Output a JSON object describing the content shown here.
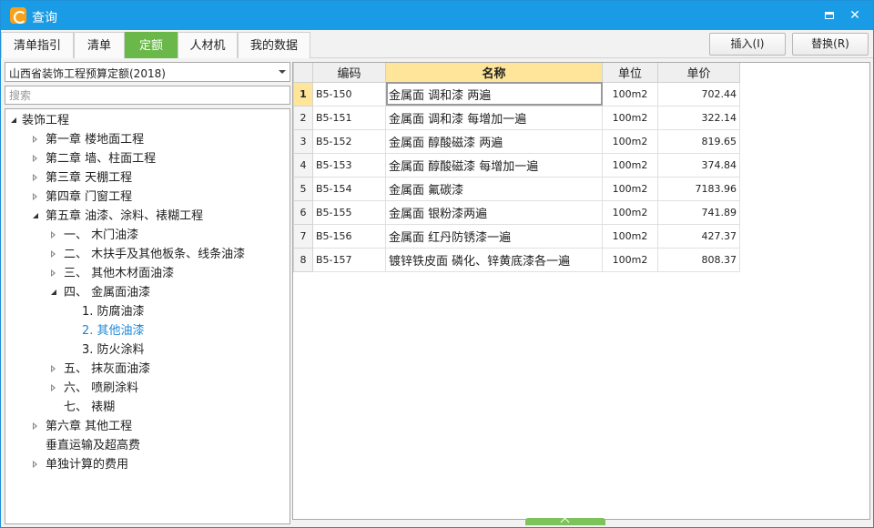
{
  "window": {
    "title": "查询"
  },
  "tabs": [
    {
      "label": "清单指引"
    },
    {
      "label": "清单"
    },
    {
      "label": "定额",
      "active": true
    },
    {
      "label": "人材机"
    },
    {
      "label": "我的数据"
    }
  ],
  "toolbar": {
    "insert_label": "插入(I)",
    "replace_label": "替换(R)"
  },
  "quota_library": {
    "selected": "山西省装饰工程预算定额(2018)"
  },
  "search": {
    "placeholder": "搜索"
  },
  "tree": [
    {
      "label": "装饰工程",
      "level": 0,
      "state": "open"
    },
    {
      "label": "第一章 楼地面工程",
      "level": 1,
      "state": "closed"
    },
    {
      "label": "第二章 墙、柱面工程",
      "level": 1,
      "state": "closed"
    },
    {
      "label": "第三章 天棚工程",
      "level": 1,
      "state": "closed"
    },
    {
      "label": "第四章 门窗工程",
      "level": 1,
      "state": "closed"
    },
    {
      "label": "第五章 油漆、涂料、裱糊工程",
      "level": 1,
      "state": "open"
    },
    {
      "label": "一、 木门油漆",
      "level": 2,
      "state": "closed"
    },
    {
      "label": "二、 木扶手及其他板条、线条油漆",
      "level": 2,
      "state": "closed"
    },
    {
      "label": "三、 其他木材面油漆",
      "level": 2,
      "state": "closed"
    },
    {
      "label": "四、 金属面油漆",
      "level": 2,
      "state": "open"
    },
    {
      "label": "1. 防腐油漆",
      "level": 3,
      "state": "leaf"
    },
    {
      "label": "2. 其他油漆",
      "level": 3,
      "state": "leaf",
      "selected": true
    },
    {
      "label": "3. 防火涂料",
      "level": 3,
      "state": "leaf"
    },
    {
      "label": "五、 抹灰面油漆",
      "level": 2,
      "state": "closed"
    },
    {
      "label": "六、 喷刷涂料",
      "level": 2,
      "state": "closed"
    },
    {
      "label": "七、 裱糊",
      "level": 2,
      "state": "leaf"
    },
    {
      "label": "第六章 其他工程",
      "level": 1,
      "state": "closed"
    },
    {
      "label": "垂直运输及超高费",
      "level": 1,
      "state": "leaf"
    },
    {
      "label": "单独计算的费用",
      "level": 1,
      "state": "closed"
    }
  ],
  "grid": {
    "columns": [
      "编码",
      "名称",
      "单位",
      "单价"
    ],
    "rows": [
      {
        "no": "1",
        "code": "B5-150",
        "name": "金属面 调和漆 两遍",
        "unit": "100m2",
        "price": "702.44"
      },
      {
        "no": "2",
        "code": "B5-151",
        "name": "金属面 调和漆 每增加一遍",
        "unit": "100m2",
        "price": "322.14"
      },
      {
        "no": "3",
        "code": "B5-152",
        "name": "金属面 醇酸磁漆 两遍",
        "unit": "100m2",
        "price": "819.65"
      },
      {
        "no": "4",
        "code": "B5-153",
        "name": "金属面 醇酸磁漆 每增加一遍",
        "unit": "100m2",
        "price": "374.84"
      },
      {
        "no": "5",
        "code": "B5-154",
        "name": "金属面 氟碳漆",
        "unit": "100m2",
        "price": "7183.96"
      },
      {
        "no": "6",
        "code": "B5-155",
        "name": "金属面 银粉漆两遍",
        "unit": "100m2",
        "price": "741.89"
      },
      {
        "no": "7",
        "code": "B5-156",
        "name": "金属面 红丹防锈漆一遍",
        "unit": "100m2",
        "price": "427.37"
      },
      {
        "no": "8",
        "code": "B5-157",
        "name": "镀锌铁皮面 磷化、锌黄底漆各一遍",
        "unit": "100m2",
        "price": "808.37"
      }
    ]
  },
  "colors": {
    "titlebar": "#1a9be6",
    "active_tab": "#6ab84a",
    "header_highlight": "#ffe59a",
    "selected_text": "#1e88d6"
  }
}
